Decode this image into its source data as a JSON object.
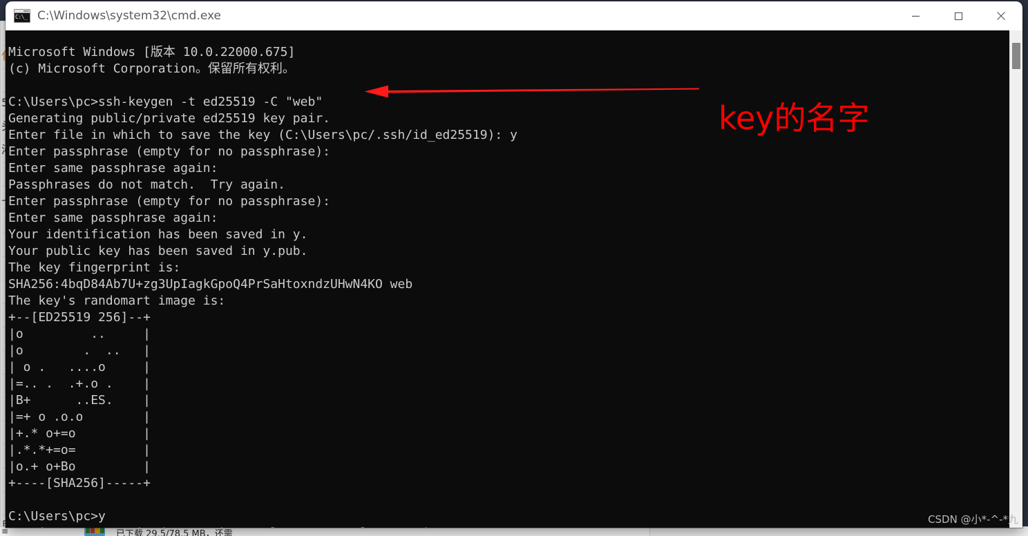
{
  "window": {
    "title": "C:\\Windows\\system32\\cmd.exe",
    "icon_name": "cmd-console-icon",
    "icon_glyph": "C:\\_",
    "controls": {
      "minimize_label": "Minimize",
      "maximize_label": "Maximize",
      "close_label": "Close"
    }
  },
  "terminal": {
    "lines": [
      "Microsoft Windows [版本 10.0.22000.675]",
      "(c) Microsoft Corporation。保留所有权利。",
      "",
      "C:\\Users\\pc>ssh-keygen -t ed25519 -C \"web\"",
      "Generating public/private ed25519 key pair.",
      "Enter file in which to save the key (C:\\Users\\pc/.ssh/id_ed25519): y",
      "Enter passphrase (empty for no passphrase):",
      "Enter same passphrase again:",
      "Passphrases do not match.  Try again.",
      "Enter passphrase (empty for no passphrase):",
      "Enter same passphrase again:",
      "Your identification has been saved in y.",
      "Your public key has been saved in y.pub.",
      "The key fingerprint is:",
      "SHA256:4bqD84Ab7U+zg3UpIagkGpoQ4PrSaHtoxndzUHwN4KO web",
      "The key's randomart image is:",
      "+--[ED25519 256]--+",
      "|o         ..     |",
      "|o        .  ..   |",
      "| o .   ....o     |",
      "|=.. .  .+.o .    |",
      "|B+      ..ES.    |",
      "|=+ o .o.o        |",
      "|+.* o+=o         |",
      "|.*.*+=o=         |",
      "|o.+ o+Bo         |",
      "+----[SHA256]-----+",
      "",
      "C:\\Users\\pc>y",
      "'y' is not recognized as an internal or external command,"
    ],
    "prompt": "C:\\Users\\pc>",
    "background_color": "#0c0c0c",
    "text_color": "#cccccc"
  },
  "annotations": {
    "arrow_name": "red-arrow-pointing-left",
    "arrow_color": "#ff1a1a",
    "label_text": "key的名字",
    "label_color": "#ff0000"
  },
  "scrollbar": {
    "thumb_name": "vertical-scroll-thumb"
  },
  "background_windows": {
    "left_strip_lines": [
      "",
      "化",
      "",
      "5",
      "头",
      "沁",
      "",
      "上",
      "",
      "",
      "",
      "",
      "",
      "",
      "",
      "",
      "",
      "",
      "",
      "",
      "",
      "目"
    ],
    "bottom_status": "已下载 29.5/78.5 MB，还需"
  },
  "watermark": {
    "text": "CSDN @小*-^-*九"
  }
}
